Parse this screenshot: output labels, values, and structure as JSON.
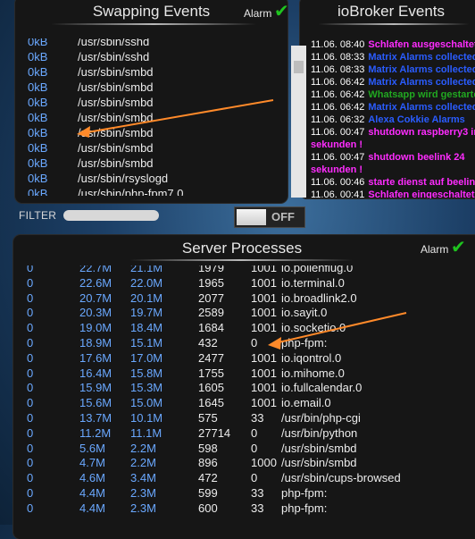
{
  "swapping": {
    "title": "Swapping Events",
    "alarm_label": "Alarm",
    "rows": [
      {
        "size": "0kB",
        "process": "/usr/sbin/sshd"
      },
      {
        "size": "0kB",
        "process": "/usr/sbin/sshd"
      },
      {
        "size": "0kB",
        "process": "/usr/sbin/smbd"
      },
      {
        "size": "0kB",
        "process": "/usr/sbin/smbd"
      },
      {
        "size": "0kB",
        "process": "/usr/sbin/smbd"
      },
      {
        "size": "0kB",
        "process": "/usr/sbin/smbd"
      },
      {
        "size": "0kB",
        "process": "/usr/sbin/smbd"
      },
      {
        "size": "0kB",
        "process": "/usr/sbin/smbd"
      },
      {
        "size": "0kB",
        "process": "/usr/sbin/smbd"
      },
      {
        "size": "0kB",
        "process": "/usr/sbin/rsyslogd"
      },
      {
        "size": "0kB",
        "process": "/usr/sbin/php-fpm7.0"
      }
    ]
  },
  "iobroker": {
    "title": "ioBroker Events",
    "rows": [
      {
        "time": "11.06. 08:40",
        "msg": "Schlafen ausgeschaltet",
        "color": "#ff2cff"
      },
      {
        "time": "11.06. 08:33",
        "msg": "Matrix Alarms collected",
        "color": "#2a5cff"
      },
      {
        "time": "11.06. 08:33",
        "msg": "Matrix Alarms collected",
        "color": "#2a5cff"
      },
      {
        "time": "11.06. 06:42",
        "msg": "Matrix Alarms collected",
        "color": "#2a5cff"
      },
      {
        "time": "11.06. 06:42",
        "msg": "Whatsapp wird gestartet",
        "color": "#21a821"
      },
      {
        "time": "11.06. 06:42",
        "msg": "Matrix Alarms collected",
        "color": "#2a5cff"
      },
      {
        "time": "11.06. 06:32",
        "msg": "Alexa Cokkie Alarms",
        "color": "#2a5cff"
      },
      {
        "time": "11.06. 00:47",
        "msg": "shutdown raspberry3 in 1",
        "color": "#ff2cff"
      },
      {
        "time": "",
        "msg": "sekunden !",
        "color": "#ff2cff"
      },
      {
        "time": "11.06. 00:47",
        "msg": "shutdown beelink 24",
        "color": "#ff2cff"
      },
      {
        "time": "",
        "msg": "sekunden !",
        "color": "#ff2cff"
      },
      {
        "time": "11.06. 00:46",
        "msg": "starte dienst auf beelink",
        "color": "#ff2cff"
      },
      {
        "time": "11.06. 00:41",
        "msg": "Schlafen eingeschaltet",
        "color": "#ff2cff"
      }
    ]
  },
  "filter": {
    "label": "FILTER",
    "value": "",
    "toggle_label": "OFF"
  },
  "processes": {
    "title": "Server Processes",
    "alarm_label": "Alarm",
    "rows": [
      {
        "c0": "0",
        "c1": "22.7M",
        "c2": "21.1M",
        "c3": "1979",
        "c4": "1001",
        "c5": "io.pollenflug.0"
      },
      {
        "c0": "0",
        "c1": "22.6M",
        "c2": "22.0M",
        "c3": "1965",
        "c4": "1001",
        "c5": "io.terminal.0"
      },
      {
        "c0": "0",
        "c1": "20.7M",
        "c2": "20.1M",
        "c3": "2077",
        "c4": "1001",
        "c5": "io.broadlink2.0"
      },
      {
        "c0": "0",
        "c1": "20.3M",
        "c2": "19.7M",
        "c3": "2589",
        "c4": "1001",
        "c5": "io.sayit.0"
      },
      {
        "c0": "0",
        "c1": "19.0M",
        "c2": "18.4M",
        "c3": "1684",
        "c4": "1001",
        "c5": "io.socketio.0"
      },
      {
        "c0": "0",
        "c1": "18.9M",
        "c2": "15.1M",
        "c3": "432",
        "c4": "0",
        "c5": "php-fpm:"
      },
      {
        "c0": "0",
        "c1": "17.6M",
        "c2": "17.0M",
        "c3": "2477",
        "c4": "1001",
        "c5": "io.iqontrol.0"
      },
      {
        "c0": "0",
        "c1": "16.4M",
        "c2": "15.8M",
        "c3": "1755",
        "c4": "1001",
        "c5": "io.mihome.0"
      },
      {
        "c0": "0",
        "c1": "15.9M",
        "c2": "15.3M",
        "c3": "1605",
        "c4": "1001",
        "c5": "io.fullcalendar.0"
      },
      {
        "c0": "0",
        "c1": "15.6M",
        "c2": "15.0M",
        "c3": "1645",
        "c4": "1001",
        "c5": "io.email.0"
      },
      {
        "c0": "0",
        "c1": "13.7M",
        "c2": "10.1M",
        "c3": "575",
        "c4": "33",
        "c5": "/usr/bin/php-cgi"
      },
      {
        "c0": "0",
        "c1": "11.2M",
        "c2": "11.1M",
        "c3": "27714",
        "c4": "0",
        "c5": "/usr/bin/python"
      },
      {
        "c0": "0",
        "c1": "5.6M",
        "c2": "2.2M",
        "c3": "598",
        "c4": "0",
        "c5": "/usr/sbin/smbd"
      },
      {
        "c0": "0",
        "c1": "4.7M",
        "c2": "2.2M",
        "c3": "896",
        "c4": "1000",
        "c5": "/usr/sbin/smbd"
      },
      {
        "c0": "0",
        "c1": "4.6M",
        "c2": "3.4M",
        "c3": "472",
        "c4": "0",
        "c5": "/usr/sbin/cups-browsed"
      },
      {
        "c0": "0",
        "c1": "4.4M",
        "c2": "2.3M",
        "c3": "599",
        "c4": "33",
        "c5": "php-fpm:"
      },
      {
        "c0": "0",
        "c1": "4.4M",
        "c2": "2.3M",
        "c3": "600",
        "c4": "33",
        "c5": "php-fpm:"
      }
    ]
  },
  "colors": {
    "size_blue": "#6aa8ff",
    "alarm_check": "#1fc41f",
    "annotation_arrow": "#ff8a2a"
  }
}
